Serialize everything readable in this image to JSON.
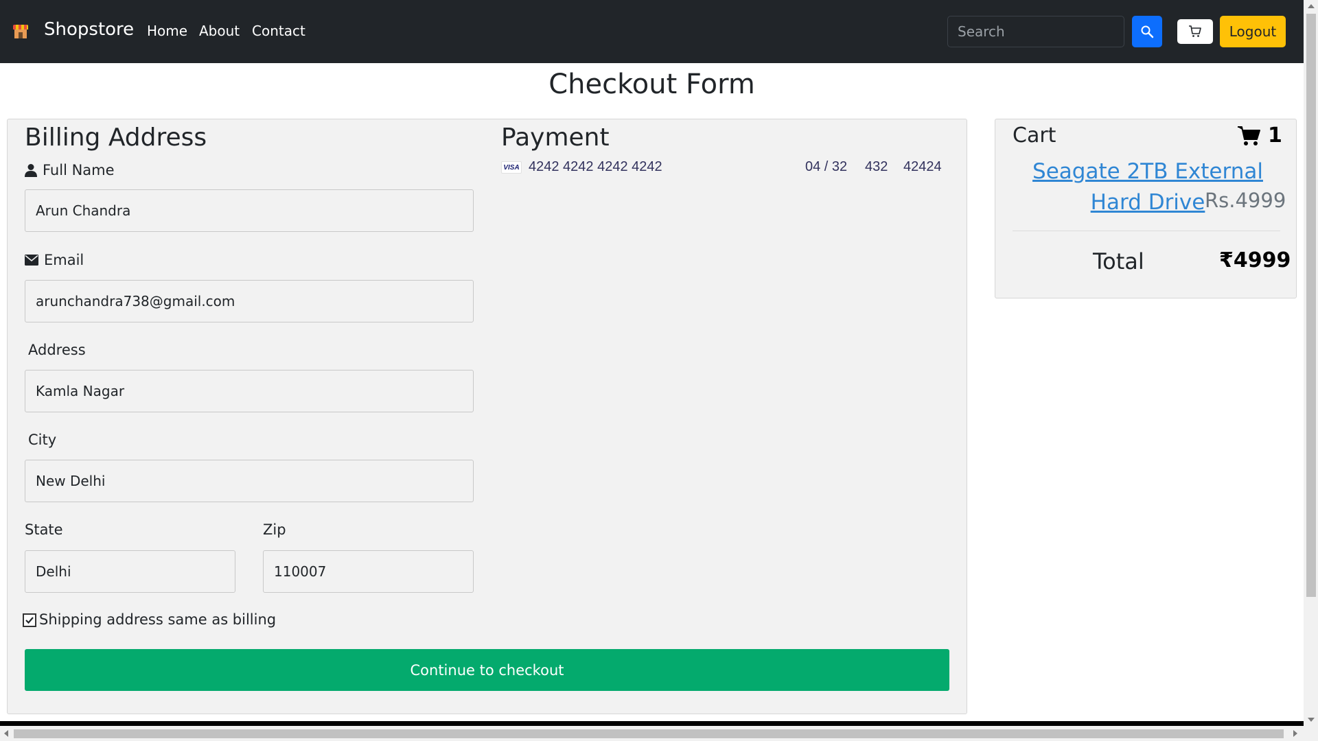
{
  "navbar": {
    "brand": "Shopstore",
    "brand_icon": "store-icon",
    "links": [
      "Home",
      "About",
      "Contact"
    ],
    "search_placeholder": "Search",
    "search_icon": "search-icon",
    "cart_icon": "cart-icon",
    "logout_label": "Logout",
    "colors": {
      "background": "#212529",
      "search_button": "#0d6efd",
      "logout_button": "#ffc107"
    }
  },
  "page": {
    "title": "Checkout Form"
  },
  "billing": {
    "title": "Billing Address",
    "full_name": {
      "label": "Full Name",
      "value": "Arun Chandra",
      "icon": "user-icon"
    },
    "email": {
      "label": "Email",
      "value": "arunchandra738@gmail.com",
      "icon": "envelope-icon"
    },
    "address": {
      "label": "Address",
      "value": "Kamla Nagar"
    },
    "city": {
      "label": "City",
      "value": "New Delhi"
    },
    "state": {
      "label": "State",
      "value": "Delhi"
    },
    "zip": {
      "label": "Zip",
      "value": "110007"
    },
    "same_as_billing": {
      "label": "Shipping address same as billing",
      "checked": true
    },
    "checkout_label": "Continue to checkout",
    "checkout_color": "#04aa6d"
  },
  "payment": {
    "title": "Payment",
    "card_brand": "VISA",
    "card_number": "4242 4242 4242 4242",
    "expiry": "04 / 32",
    "cvc": "432",
    "zip": "42424"
  },
  "cart": {
    "title": "Cart",
    "count": "1",
    "cart_icon": "shopping-cart-icon",
    "items": [
      {
        "name": "Seagate 2TB External Hard Drive",
        "price": "Rs.4999"
      }
    ],
    "total_label": "Total",
    "total_value": "₹4999",
    "link_color": "#2f86d4"
  }
}
